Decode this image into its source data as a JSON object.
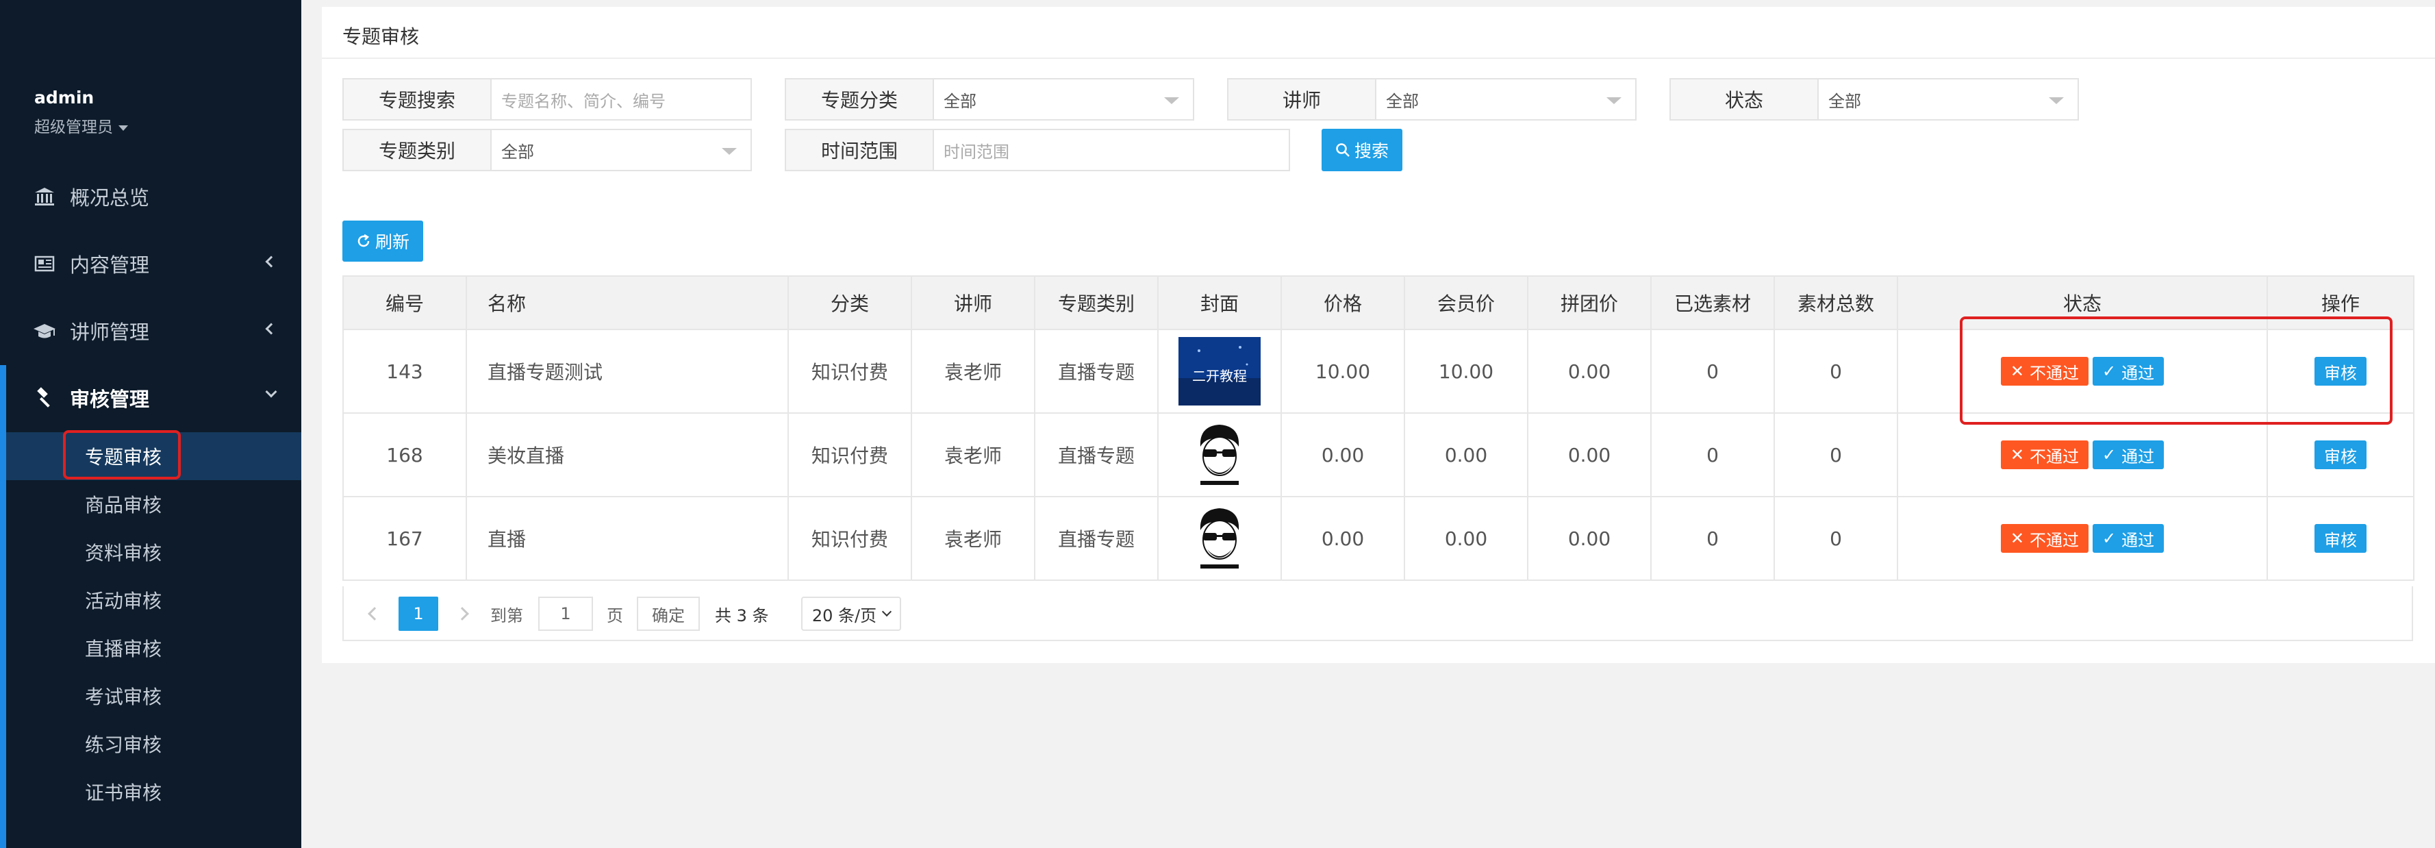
{
  "sidebar": {
    "user_name": "admin",
    "user_role": "超级管理员",
    "nav": [
      {
        "label": "概况总览",
        "icon": "bank-icon"
      },
      {
        "label": "内容管理",
        "icon": "newspaper-icon"
      },
      {
        "label": "讲师管理",
        "icon": "graduation-cap-icon"
      },
      {
        "label": "审核管理",
        "icon": "gavel-icon"
      }
    ],
    "sub_items": [
      "专题审核",
      "商品审核",
      "资料审核",
      "活动审核",
      "直播审核",
      "考试审核",
      "练习审核",
      "证书审核"
    ]
  },
  "panel": {
    "title": "专题审核"
  },
  "filters": {
    "search_label": "专题搜索",
    "search_placeholder": "专题名称、简介、编号",
    "category_label": "专题分类",
    "category_value": "全部",
    "teacher_label": "讲师",
    "teacher_value": "全部",
    "status_label": "状态",
    "status_value": "全部",
    "type_label": "专题类别",
    "type_value": "全部",
    "time_label": "时间范围",
    "time_placeholder": "时间范围",
    "search_button": "搜索"
  },
  "refresh_button": "刷新",
  "table": {
    "headers": [
      "编号",
      "名称",
      "分类",
      "讲师",
      "专题类别",
      "封面",
      "价格",
      "会员价",
      "拼团价",
      "已选素材",
      "素材总数",
      "状态",
      "操作"
    ],
    "rows": [
      {
        "id": "143",
        "name": "直播专题测试",
        "category": "知识付费",
        "teacher": "袁老师",
        "type": "直播专题",
        "cover": "course-cover",
        "cover_text": "二开教程",
        "price": "10.00",
        "vip_price": "10.00",
        "group_price": "0.00",
        "selected": "0",
        "total": "0"
      },
      {
        "id": "168",
        "name": "美妆直播",
        "category": "知识付费",
        "teacher": "袁老师",
        "type": "直播专题",
        "cover": "avatar-cover",
        "price": "0.00",
        "vip_price": "0.00",
        "group_price": "0.00",
        "selected": "0",
        "total": "0"
      },
      {
        "id": "167",
        "name": "直播",
        "category": "知识付费",
        "teacher": "袁老师",
        "type": "直播专题",
        "cover": "avatar-cover",
        "price": "0.00",
        "vip_price": "0.00",
        "group_price": "0.00",
        "selected": "0",
        "total": "0"
      }
    ],
    "reject_label": "不通过",
    "approve_label": "通过",
    "review_label": "审核"
  },
  "pagination": {
    "current_page": "1",
    "goto_label": "到第",
    "goto_value": "1",
    "page_unit": "页",
    "confirm": "确定",
    "total": "共 3 条",
    "page_size": "20 条/页"
  },
  "colors": {
    "sidebar_bg": "#0d1b2a",
    "accent": "#1e9fe6",
    "reject": "#ff5722",
    "highlight": "#e02020"
  }
}
